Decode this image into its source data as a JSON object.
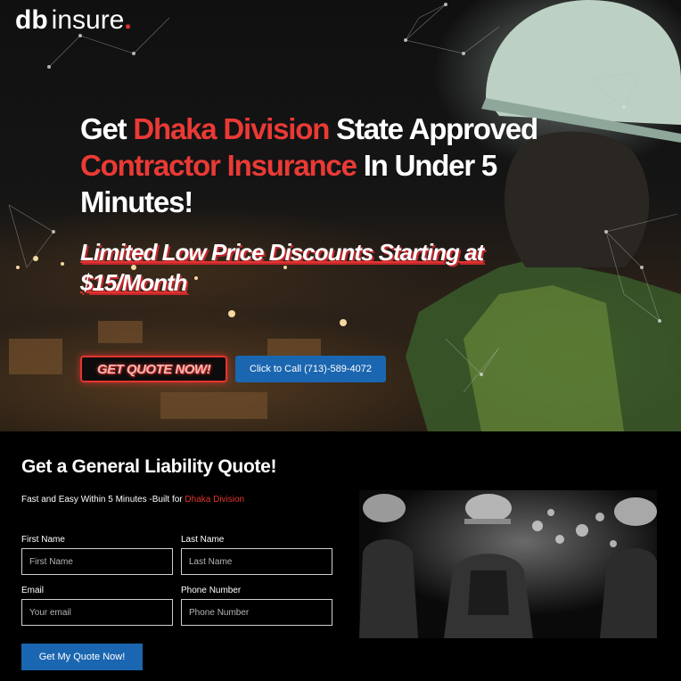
{
  "logo": {
    "db": "db",
    "insure": "insure",
    "dot": "."
  },
  "hero": {
    "headline_part1": "Get ",
    "headline_red1": "Dhaka Division",
    "headline_part2": " State Approved ",
    "headline_red2": "Contractor Insurance",
    "headline_part3": " In Under 5 Minutes!",
    "promo": "Limited Low Price Discounts Starting at $15/Month",
    "quote_button": "GET QUOTE NOW!",
    "call_button": "Click to Call (713)-589-4072"
  },
  "form": {
    "title": "Get a General Liability Quote!",
    "subtitle_prefix": "Fast and Easy Within 5 Minutes -Built for ",
    "subtitle_region": "Dhaka Division",
    "first_name_label": "First Name",
    "first_name_placeholder": "First Name",
    "last_name_label": "Last Name",
    "last_name_placeholder": "Last Name",
    "email_label": "Email",
    "email_placeholder": "Your email",
    "phone_label": "Phone Number",
    "phone_placeholder": "Phone Number",
    "submit_label": "Get My Quote Now!"
  },
  "colors": {
    "accent_red": "#e3342f",
    "button_blue": "#1b66b0",
    "background": "#000000"
  }
}
